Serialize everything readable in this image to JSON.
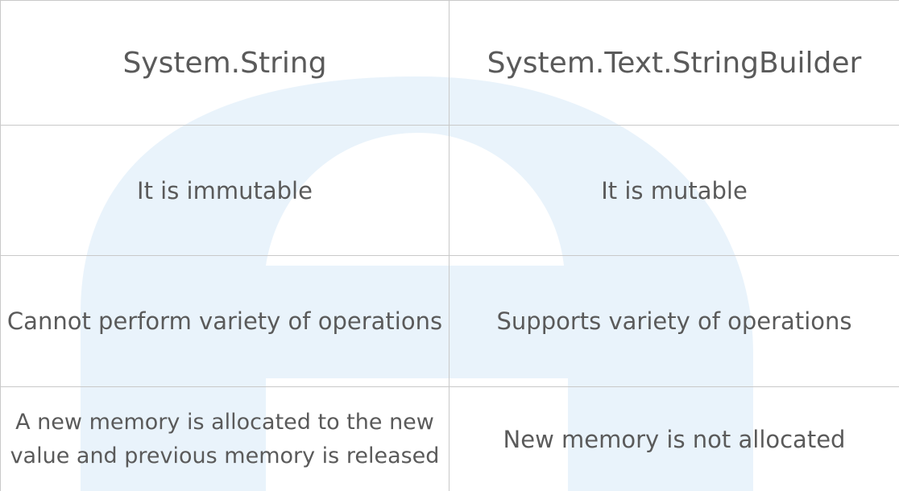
{
  "table": {
    "headers": [
      "System.String",
      "System.Text.StringBuilder"
    ],
    "rows": [
      [
        "It is immutable",
        "It is mutable"
      ],
      [
        "Cannot perform variety of operations",
        "Supports variety of operations"
      ],
      [
        "A new memory is allocated  to the new value and previous memory is released",
        "New memory is not allocated"
      ]
    ]
  },
  "colors": {
    "header_left_bg": "#f3d552",
    "header_right_bg": "#000000",
    "header_right_text": "#ffffff",
    "body_text": "#5a5a5a",
    "grid": "#c9c9c9",
    "watermark": "#e9f3fb"
  },
  "watermark": {
    "icon": "letter-e-logo-watermark"
  }
}
